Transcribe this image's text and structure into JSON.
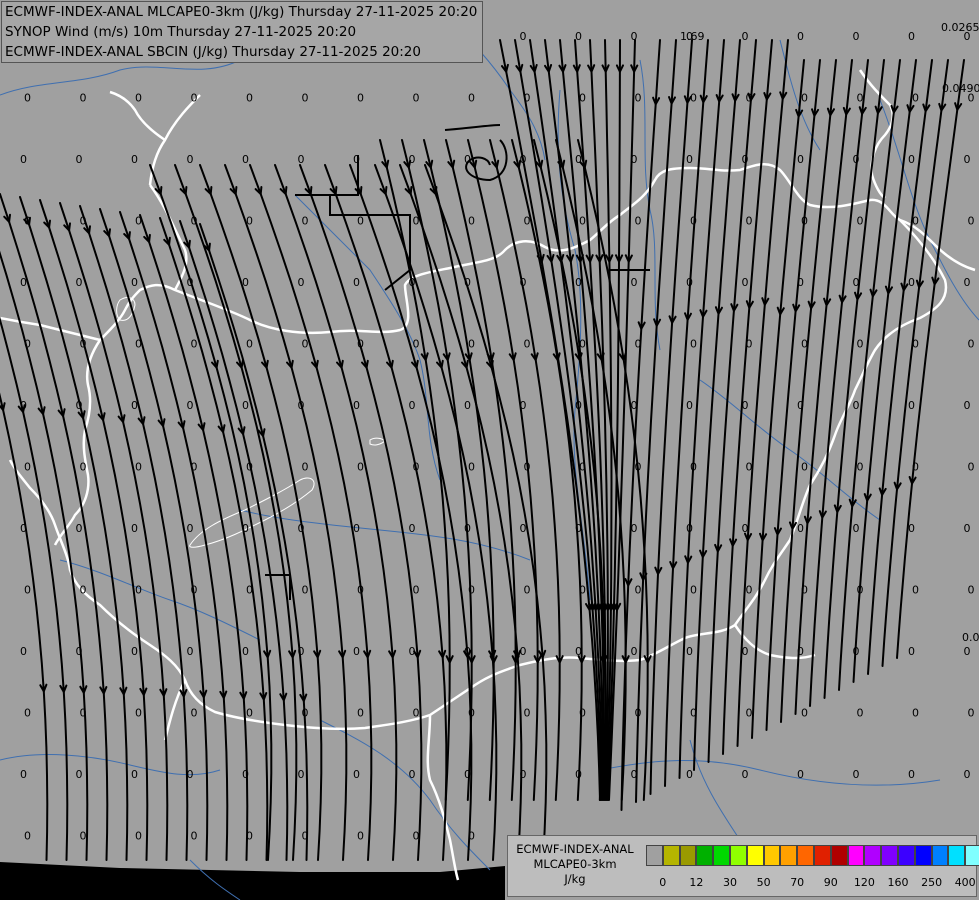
{
  "titles": [
    "ECMWF-INDEX-ANAL MLCAPE0-3km (J/kg) Thursday 27-11-2025 20:20",
    "SYNOP Wind (m/s) 10m Thursday 27-11-2025 20:20",
    "ECMWF-INDEX-ANAL SBCIN (J/kg) Thursday 27-11-2025 20:20"
  ],
  "legend": {
    "line1": "ECMWF-INDEX-ANAL",
    "line2": "MLCAPE0-3km",
    "unit": "J/kg",
    "colors": [
      "#a0a0a0",
      "#b5b500",
      "#9a9a00",
      "#00b000",
      "#00d800",
      "#90ff00",
      "#ffff00",
      "#ffc800",
      "#ffa000",
      "#ff6600",
      "#e02000",
      "#b00000",
      "#ff00ff",
      "#b000ff",
      "#8000ff",
      "#3c00ff",
      "#0000ff",
      "#0080ff",
      "#00e0ff",
      "#80ffff",
      "#ffffff"
    ],
    "ticks": [
      {
        "label": "0",
        "index": 1
      },
      {
        "label": "12",
        "index": 3
      },
      {
        "label": "30",
        "index": 5
      },
      {
        "label": "50",
        "index": 7
      },
      {
        "label": "70",
        "index": 9
      },
      {
        "label": "90",
        "index": 11
      },
      {
        "label": "120",
        "index": 13
      },
      {
        "label": "160",
        "index": 15
      },
      {
        "label": "250",
        "index": 17
      },
      {
        "label": "400",
        "index": 19
      }
    ]
  },
  "annotations": {
    "cin_a": "0.0265",
    "cin_b": "0.0490",
    "cin_c": "1.69",
    "cin_d": "0.0"
  },
  "sbcin_values": {
    "default": "0"
  },
  "colors": {
    "background": "#a0a0a0",
    "borders": "#ffffff",
    "rivers": "#3f6fb0",
    "streamlines": "#000000",
    "outside": "#000000"
  }
}
